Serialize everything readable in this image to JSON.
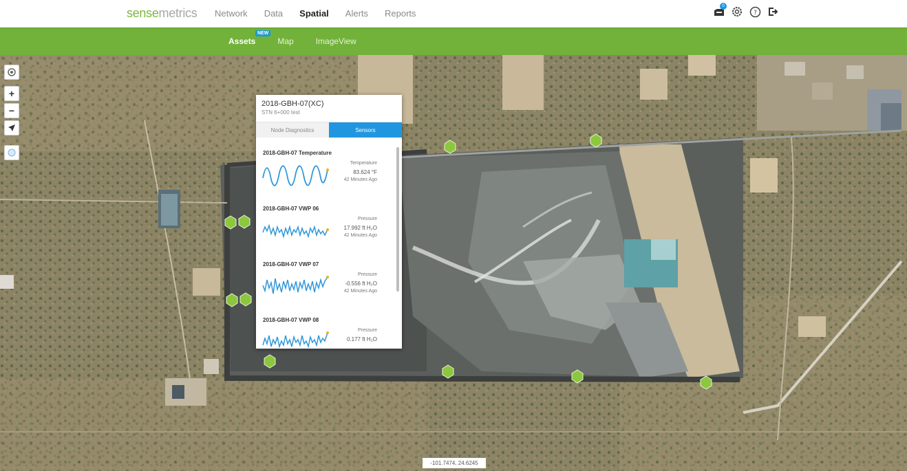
{
  "header": {
    "logo_part1": "sense",
    "logo_part2": "metrics",
    "nav": [
      {
        "label": "Network"
      },
      {
        "label": "Data"
      },
      {
        "label": "Spatial"
      },
      {
        "label": "Alerts"
      },
      {
        "label": "Reports"
      }
    ],
    "active_nav": "Spatial",
    "notification_count": "0",
    "icons": [
      "inbox-icon",
      "gear-icon",
      "help-icon",
      "logout-icon"
    ]
  },
  "subnav": {
    "items": [
      {
        "label": "Assets"
      },
      {
        "label": "Map"
      },
      {
        "label": "ImageView"
      }
    ],
    "active": "Assets",
    "new_badge": "NEW"
  },
  "map": {
    "controls": [
      "layers-icon",
      "+",
      "−",
      "locate-icon",
      "globe-icon"
    ],
    "coordinates": "-101.7474, 24.6245"
  },
  "popup": {
    "title": "2018-GBH-07(XC)",
    "subtitle": "STN 6+000 test",
    "tabs": [
      {
        "label": "Node Diagnostics"
      },
      {
        "label": "Sensors"
      }
    ],
    "active_tab": "Sensors",
    "sensors": [
      {
        "name": "2018-GBH-07 Temperature",
        "type": "Temperature",
        "value": "83.624 °F",
        "time": "42 Minutes Ago"
      },
      {
        "name": "2018-GBH-07 VWP 06",
        "type": "Pressure",
        "value": "17.992 ft H₂O",
        "time": "42 Minutes Ago"
      },
      {
        "name": "2018-GBH-07 VWP 07",
        "type": "Pressure",
        "value": "-0.556 ft H₂O",
        "time": "42 Minutes Ago"
      },
      {
        "name": "2018-GBH-07 VWP 08",
        "type": "Pressure",
        "value": "0.177 ft H₂O",
        "time": ""
      }
    ]
  },
  "colors": {
    "brand_green": "#72b13a",
    "logo_green": "#7db83a",
    "tab_blue": "#2196e0",
    "marker_green": "#8dc63f",
    "sparkline_blue": "#2f97d9"
  }
}
